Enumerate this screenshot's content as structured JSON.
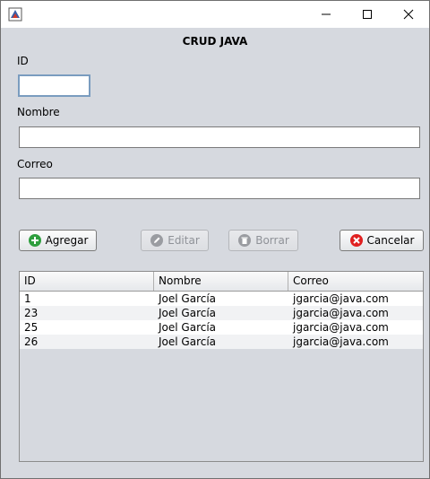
{
  "window": {
    "icon": "java-app-icon",
    "controls": {
      "minimize": "minimize-icon",
      "maximize": "maximize-icon",
      "close": "close-icon"
    }
  },
  "form": {
    "title": "CRUD JAVA",
    "id_label": "ID",
    "id_value": "",
    "nombre_label": "Nombre",
    "nombre_value": "",
    "correo_label": "Correo",
    "correo_value": ""
  },
  "buttons": {
    "agregar": {
      "label": "Agregar",
      "icon": "add-icon",
      "enabled": true
    },
    "editar": {
      "label": "Editar",
      "icon": "edit-icon",
      "enabled": false
    },
    "borrar": {
      "label": "Borrar",
      "icon": "trash-icon",
      "enabled": false
    },
    "cancelar": {
      "label": "Cancelar",
      "icon": "cancel-icon",
      "enabled": true
    }
  },
  "table": {
    "columns": [
      "ID",
      "Nombre",
      "Correo"
    ],
    "rows": [
      [
        "1",
        "Joel García",
        "jgarcia@java.com"
      ],
      [
        "23",
        "Joel García",
        "jgarcia@java.com"
      ],
      [
        "25",
        "Joel García",
        "jgarcia@java.com"
      ],
      [
        "26",
        "Joel García",
        "jgarcia@java.com"
      ]
    ]
  },
  "colors": {
    "background": "#d6d9df",
    "add_green": "#2e9e3e",
    "cancel_red": "#e02020",
    "disabled_gray": "#9a9ca1"
  }
}
